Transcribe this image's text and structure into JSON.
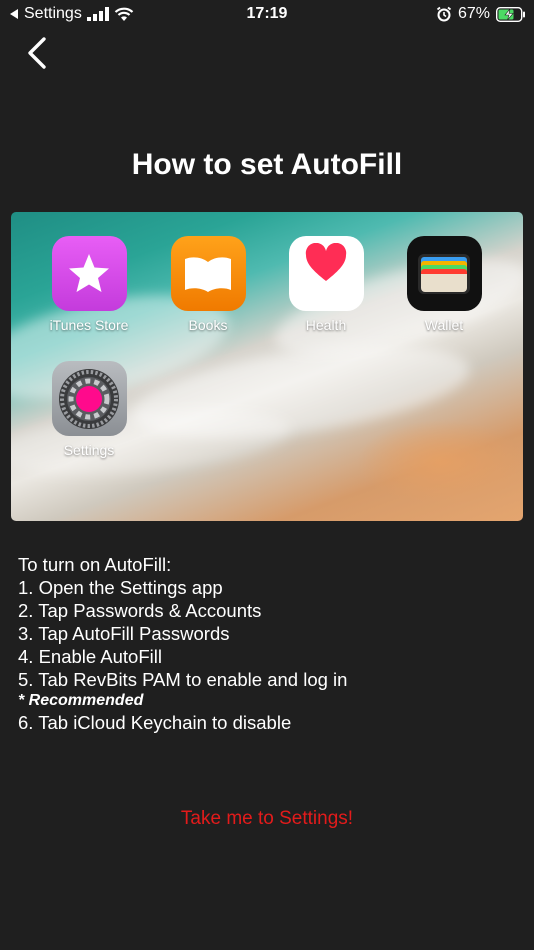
{
  "status_bar": {
    "back_app": "Settings",
    "time": "17:19",
    "battery": "67%"
  },
  "header": {
    "title": "How to set AutoFill"
  },
  "hero": {
    "apps": [
      {
        "label": "iTunes Store",
        "icon": "itunes-store-icon"
      },
      {
        "label": "Books",
        "icon": "books-icon"
      },
      {
        "label": "Health",
        "icon": "health-icon"
      },
      {
        "label": "Wallet",
        "icon": "wallet-icon"
      },
      {
        "label": "Settings",
        "icon": "settings-icon"
      }
    ]
  },
  "instructions": {
    "intro": "To turn on AutoFill:",
    "steps": [
      "1. Open the Settings app",
      "2. Tap Passwords & Accounts",
      "3. Tap AutoFill Passwords",
      "4. Enable AutoFill",
      "5. Tab RevBits PAM to enable and log in"
    ],
    "recommended": "* Recommended",
    "last_step": "6. Tab iCloud Keychain to disable"
  },
  "actions": {
    "settings_link": "Take me to Settings!"
  },
  "colors": {
    "background": "#1f1f1f",
    "link": "#e31b1b",
    "highlight": "#ff0a8c"
  }
}
